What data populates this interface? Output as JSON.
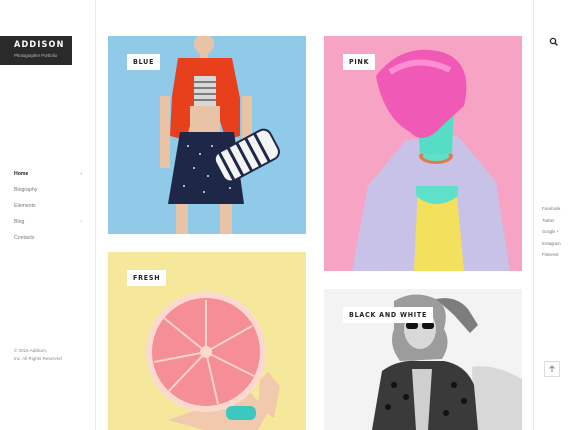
{
  "brand": {
    "title": "ADDISON",
    "subtitle": "Photographer Portfolio"
  },
  "nav": {
    "items": [
      {
        "label": "Home",
        "has_children": true,
        "chev": "›",
        "active": true
      },
      {
        "label": "Biography",
        "has_children": false
      },
      {
        "label": "Elements",
        "has_children": false
      },
      {
        "label": "Blog",
        "has_children": true,
        "chev": "›"
      },
      {
        "label": "Contacts",
        "has_children": false
      }
    ]
  },
  "footer": {
    "line1": "© 2016 Addison,",
    "line2": "Inc. All Rights Reserved"
  },
  "gallery": {
    "tiles": [
      {
        "label": "BLUE",
        "bg": "#8fcbe8"
      },
      {
        "label": "PINK",
        "bg": "#f7a3c4"
      },
      {
        "label": "FRESH",
        "bg": "#f6e89a"
      },
      {
        "label": "BLACK AND WHITE",
        "bg": "#f3f3f3"
      }
    ]
  },
  "social": {
    "items": [
      "Facebook",
      "Twitter",
      "Google +",
      "Instagram",
      "Pinterest"
    ]
  },
  "icons": {
    "search": "search-icon",
    "back_to_top": "arrow-up-icon",
    "chevron": "chevron-right-icon"
  },
  "colors": {
    "logo_bg": "#2a2a2a",
    "border": "#ececec"
  }
}
